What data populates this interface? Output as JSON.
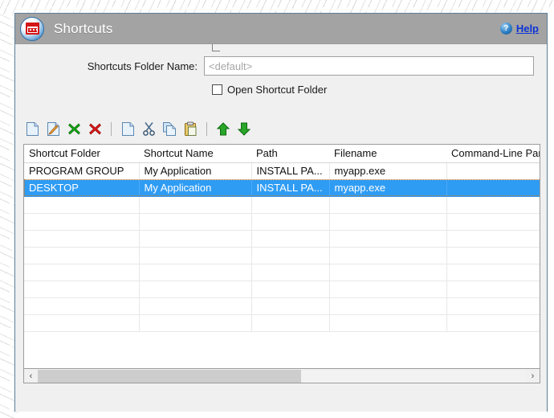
{
  "window": {
    "title": "Shortcuts",
    "icon": "shortcuts-grid-icon",
    "help_label": "Help",
    "help_icon": "?",
    "border_color": "#5b7f99",
    "titlebar_color": "#a3a3a3",
    "body_color": "#f0f0f0"
  },
  "form": {
    "folder_name_label": "Shortcuts Folder Name:",
    "folder_name_value": "",
    "folder_name_placeholder": "<default>",
    "open_folder_label": "Open Shortcut Folder",
    "open_folder_checked": false
  },
  "toolbar": {
    "buttons": [
      {
        "name": "new-shortcut-button",
        "icon": "new-document-icon",
        "label": "New"
      },
      {
        "name": "edit-shortcut-button",
        "icon": "edit-document-icon",
        "label": "Edit"
      },
      {
        "name": "delete-shortcut-button",
        "icon": "green-x-icon",
        "label": "Delete"
      },
      {
        "name": "delete-all-shortcuts-button",
        "icon": "red-x-icon",
        "label": "Delete All"
      },
      {
        "name": "separator-1",
        "icon": "separator",
        "label": ""
      },
      {
        "name": "duplicate-button",
        "icon": "duplicate-document-icon",
        "label": "Duplicate"
      },
      {
        "name": "cut-button",
        "icon": "scissors-icon",
        "label": "Cut"
      },
      {
        "name": "copy-button",
        "icon": "copy-icon",
        "label": "Copy"
      },
      {
        "name": "paste-button",
        "icon": "clipboard-paste-icon",
        "label": "Paste"
      },
      {
        "name": "separator-2",
        "icon": "separator",
        "label": ""
      },
      {
        "name": "move-up-button",
        "icon": "green-up-arrow-icon",
        "label": "Move Up"
      },
      {
        "name": "move-down-button",
        "icon": "green-down-arrow-icon",
        "label": "Move Down"
      }
    ]
  },
  "grid": {
    "columns": [
      "Shortcut Folder",
      "Shortcut Name",
      "Path",
      "Filename",
      "Command-Line Par"
    ],
    "rows": [
      {
        "selected": false,
        "cells": [
          "PROGRAM GROUP",
          "My Application",
          "INSTALL PA...",
          "myapp.exe",
          ""
        ]
      },
      {
        "selected": true,
        "cells": [
          "DESKTOP",
          "My Application",
          "INSTALL PA...",
          "myapp.exe",
          ""
        ]
      }
    ],
    "empty_row_count": 8,
    "selection_color": "#2f9cf4",
    "focus_outline_color": "#c07a2a"
  },
  "scrollbar": {
    "left_arrow": "‹",
    "right_arrow": "›",
    "thumb_percent": 54
  }
}
